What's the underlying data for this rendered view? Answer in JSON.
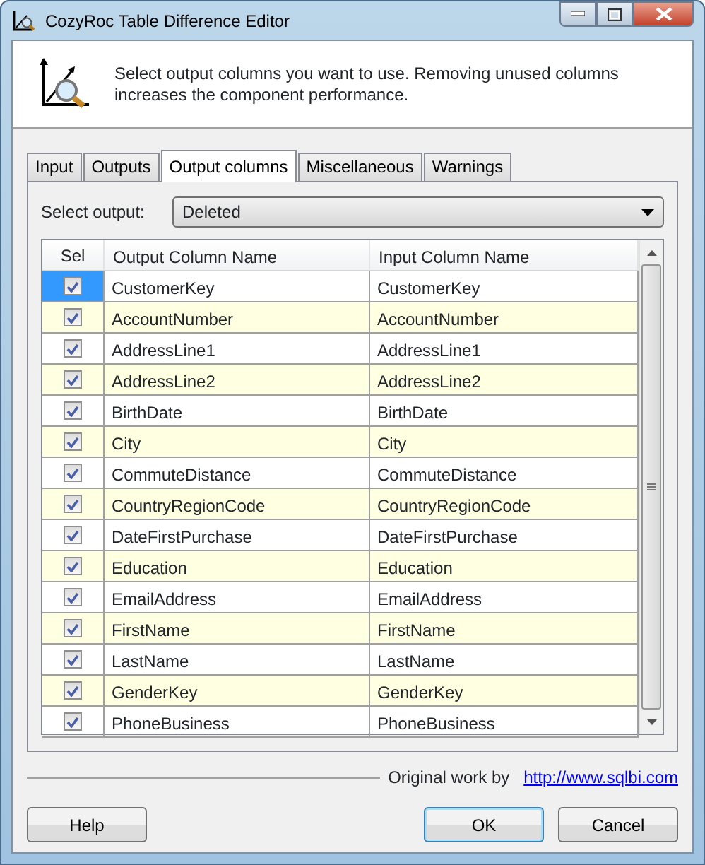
{
  "window": {
    "title": "CozyRoc Table Difference Editor"
  },
  "header": {
    "description": "Select output columns you want to use. Removing unused columns increases the component performance."
  },
  "tabs": [
    {
      "label": "Input",
      "selected": false
    },
    {
      "label": "Outputs",
      "selected": false
    },
    {
      "label": "Output columns",
      "selected": true
    },
    {
      "label": "Miscellaneous",
      "selected": false
    },
    {
      "label": "Warnings",
      "selected": false
    }
  ],
  "select_output": {
    "label": "Select output:",
    "value": "Deleted"
  },
  "table": {
    "columns": [
      "Sel",
      "Output Column Name",
      "Input Column Name"
    ],
    "rows": [
      {
        "checked": true,
        "selected": true,
        "output": "CustomerKey",
        "input": "CustomerKey"
      },
      {
        "checked": true,
        "selected": false,
        "output": "AccountNumber",
        "input": "AccountNumber"
      },
      {
        "checked": true,
        "selected": false,
        "output": "AddressLine1",
        "input": "AddressLine1"
      },
      {
        "checked": true,
        "selected": false,
        "output": "AddressLine2",
        "input": "AddressLine2"
      },
      {
        "checked": true,
        "selected": false,
        "output": "BirthDate",
        "input": "BirthDate"
      },
      {
        "checked": true,
        "selected": false,
        "output": "City",
        "input": "City"
      },
      {
        "checked": true,
        "selected": false,
        "output": "CommuteDistance",
        "input": "CommuteDistance"
      },
      {
        "checked": true,
        "selected": false,
        "output": "CountryRegionCode",
        "input": "CountryRegionCode"
      },
      {
        "checked": true,
        "selected": false,
        "output": "DateFirstPurchase",
        "input": "DateFirstPurchase"
      },
      {
        "checked": true,
        "selected": false,
        "output": "Education",
        "input": "Education"
      },
      {
        "checked": true,
        "selected": false,
        "output": "EmailAddress",
        "input": "EmailAddress"
      },
      {
        "checked": true,
        "selected": false,
        "output": "FirstName",
        "input": "FirstName"
      },
      {
        "checked": true,
        "selected": false,
        "output": "LastName",
        "input": "LastName"
      },
      {
        "checked": true,
        "selected": false,
        "output": "GenderKey",
        "input": "GenderKey"
      },
      {
        "checked": true,
        "selected": false,
        "output": "PhoneBusiness",
        "input": "PhoneBusiness"
      }
    ]
  },
  "credit": {
    "text": "Original work by",
    "link": "http://www.sqlbi.com"
  },
  "buttons": [
    {
      "label": "Help",
      "default": false
    },
    {
      "label": "OK",
      "default": true
    },
    {
      "label": "Cancel",
      "default": false
    }
  ]
}
